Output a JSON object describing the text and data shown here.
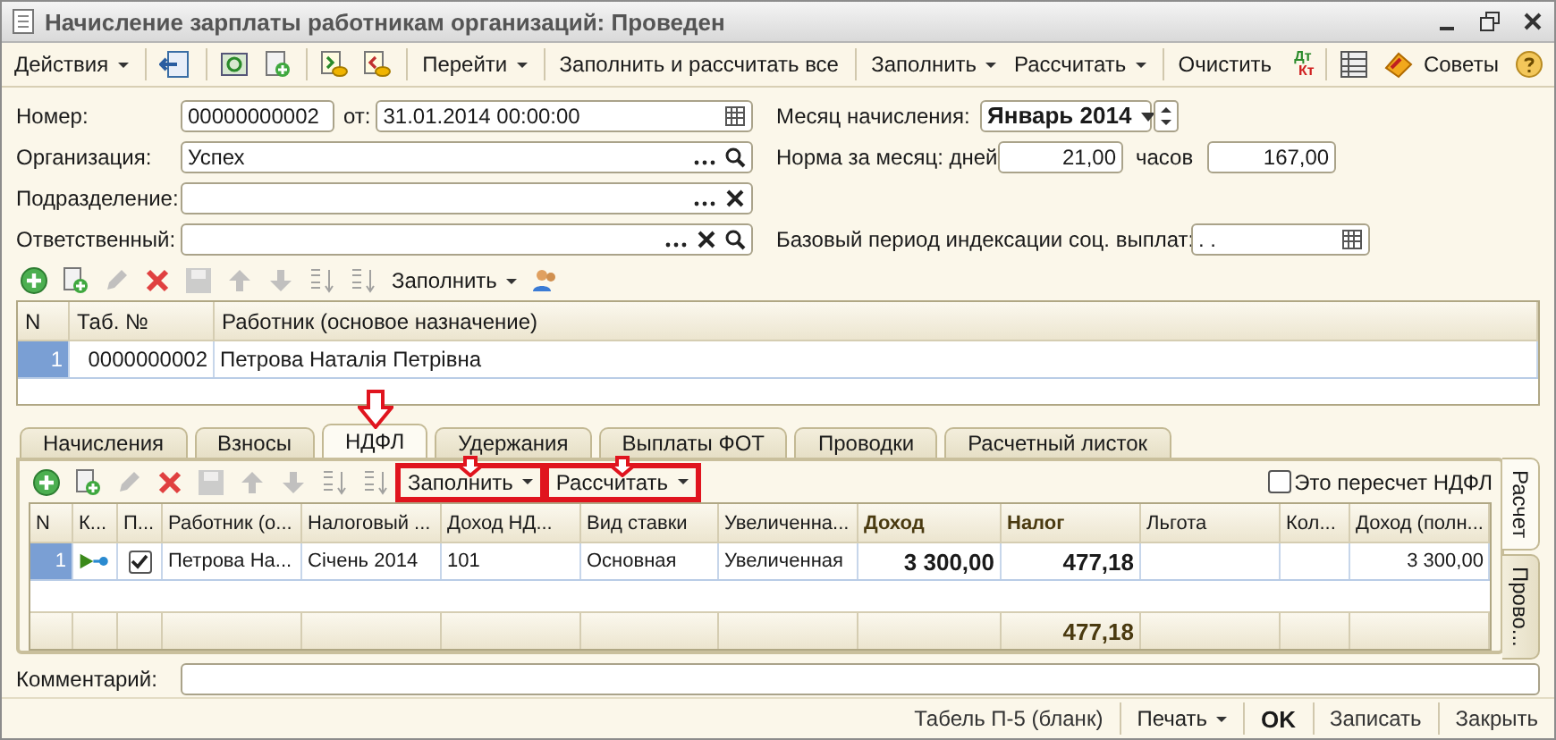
{
  "window": {
    "title": "Начисление зарплаты работникам организаций: Проведен"
  },
  "toolbar": {
    "actions": "Действия",
    "goto": "Перейти",
    "fill_calc_all": "Заполнить и рассчитать все",
    "fill": "Заполнить",
    "calculate": "Рассчитать",
    "clear": "Очистить",
    "dt": "Дт",
    "kt": "Кт",
    "tips": "Советы"
  },
  "header": {
    "number": {
      "label": "Номер:",
      "value": "00000000002"
    },
    "date": {
      "label": "от:",
      "value": "31.01.2014 00:00:00"
    },
    "organization": {
      "label": "Организация:",
      "value": "Успех"
    },
    "department": {
      "label": "Подразделение:"
    },
    "responsible": {
      "label": "Ответственный:"
    },
    "month": {
      "label": "Месяц начисления:",
      "value": "Январь 2014"
    },
    "norm": {
      "label": "Норма за месяц: дней",
      "days": "21,00",
      "hours_label": "часов",
      "hours": "167,00"
    },
    "base_period": {
      "label": "Базовый период индексации соц. выплат:",
      "value": ". ."
    }
  },
  "employees": {
    "toolbar": {
      "fill": "Заполнить"
    },
    "columns": [
      "N",
      "Таб. №",
      "Работник (основое назначение)"
    ],
    "rows": [
      {
        "n": "1",
        "tab": "0000000002",
        "name": "Петрова Наталія Петрівна",
        "selected": true
      }
    ]
  },
  "tabs": [
    {
      "label": "Начисления",
      "selected": false,
      "marked": false
    },
    {
      "label": "Взносы",
      "selected": false,
      "marked": false
    },
    {
      "label": "НДФЛ",
      "selected": true,
      "marked": true
    },
    {
      "label": "Удержания",
      "selected": false,
      "marked": false
    },
    {
      "label": "Выплаты ФОТ",
      "selected": false,
      "marked": false
    },
    {
      "label": "Проводки",
      "selected": false,
      "marked": false
    },
    {
      "label": "Расчетный листок",
      "selected": false,
      "marked": false
    }
  ],
  "side_tabs": [
    {
      "label": "Расчет",
      "selected": true
    },
    {
      "label": "Прово...",
      "selected": false
    }
  ],
  "ndfl": {
    "toolbar": {
      "fill": {
        "label": "Заполнить",
        "highlighted": true
      },
      "calculate": {
        "label": "Рассчитать",
        "highlighted": true
      },
      "recalc": {
        "label": "Это пересчет НДФЛ",
        "checked": false
      }
    },
    "columns": [
      {
        "label": "N",
        "bold": false
      },
      {
        "label": "К...",
        "bold": false
      },
      {
        "label": "П...",
        "bold": false
      },
      {
        "label": "Работник (о...",
        "bold": false
      },
      {
        "label": "Налоговый ...",
        "bold": false
      },
      {
        "label": "Доход НД...",
        "bold": false
      },
      {
        "label": "Вид ставки",
        "bold": false
      },
      {
        "label": "Увеличенна...",
        "bold": false
      },
      {
        "label": "Доход",
        "bold": true
      },
      {
        "label": "Налог",
        "bold": true
      },
      {
        "label": "Льгота",
        "bold": false
      },
      {
        "label": "Кол...",
        "bold": false
      },
      {
        "label": "Доход (полн...",
        "bold": false
      }
    ],
    "rows": [
      {
        "n": "1",
        "selected": true,
        "checked": true,
        "worker": "Петрова На...",
        "period": "Січень 2014",
        "income_code": "101",
        "rate": "Основная",
        "increased": "Увеличенная",
        "income": "3 300,00",
        "tax": "477,18",
        "income_full": "3 300,00"
      }
    ],
    "totals": {
      "tax": "477,18"
    }
  },
  "comment": {
    "label": "Комментарий:"
  },
  "footer_buttons": [
    {
      "label": "Табель П-5 (бланк)",
      "kind": "plain"
    },
    {
      "label": "Печать",
      "kind": "menu"
    },
    {
      "label": "OK",
      "kind": "default"
    },
    {
      "label": "Записать",
      "kind": "plain"
    },
    {
      "label": "Закрыть",
      "kind": "plain"
    }
  ]
}
